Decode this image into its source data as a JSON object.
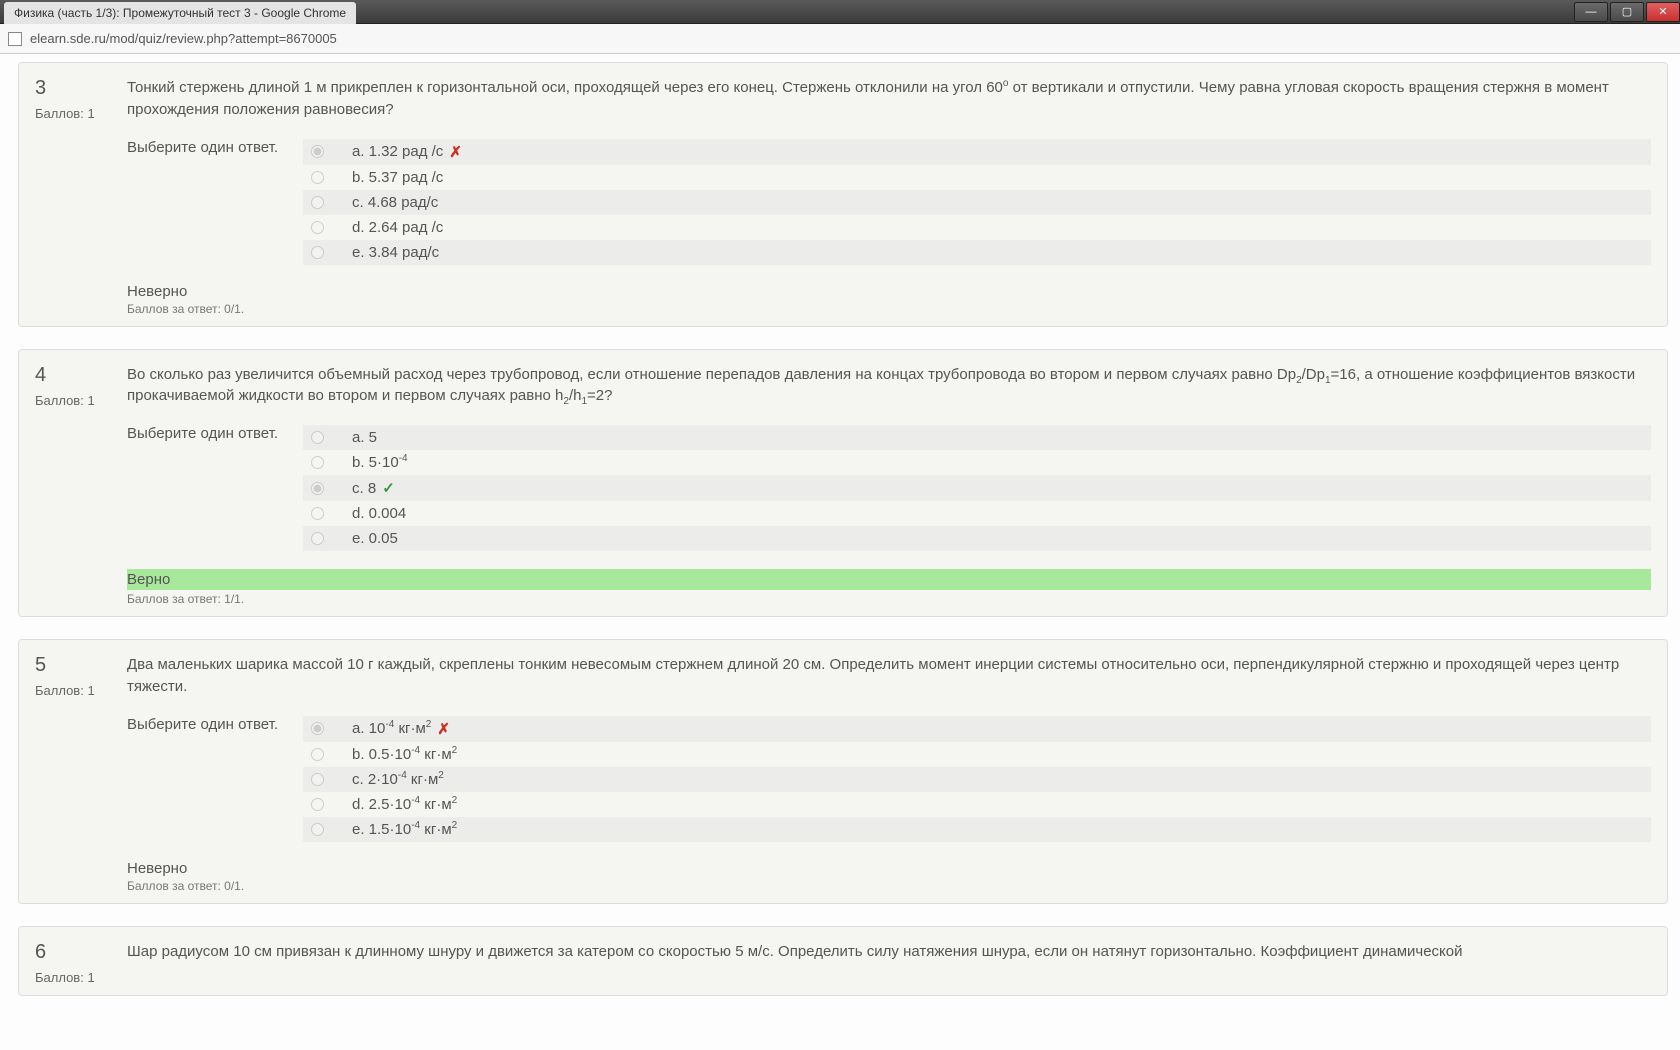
{
  "window": {
    "title": "Физика (часть 1/3): Промежуточный тест 3 - Google Chrome",
    "url": "elearn.sde.ru/mod/quiz/review.php?attempt=8670005"
  },
  "labels": {
    "points": "Баллов: 1",
    "choose": "Выберите один ответ.",
    "score_wrong": "Баллов за ответ: 0/1.",
    "score_right": "Баллов за ответ: 1/1.",
    "wrong": "Неверно",
    "right": "Верно"
  },
  "questions": [
    {
      "num": "3",
      "text_html": "Тонкий стержень длиной 1 м прикреплен к горизонтальной оси, проходящей через его конец. Стержень отклонили на угол 60<sup>o</sup> от вертикали и отпустили. Чему равна угловая скорость вращения стержня в момент прохождения положения равновесия?",
      "answers": [
        {
          "label": "a. 1.32 рад /с",
          "selected": true,
          "mark": "wrong"
        },
        {
          "label": "b. 5.37 рад /с",
          "selected": false
        },
        {
          "label": "c. 4.68 рад/с",
          "selected": false
        },
        {
          "label": "d. 2.64 рад /с",
          "selected": false
        },
        {
          "label": "e. 3.84 рад/с",
          "selected": false
        }
      ],
      "verdict": "wrong"
    },
    {
      "num": "4",
      "text_html": "Во сколько раз увеличится объемный расход через трубопровод, если отношение перепадов давления на концах трубопровода во втором и первом случаях равно Dp<sub>2</sub>/Dp<sub>1</sub>=16, а отношение коэффициентов вязкости прокачиваемой жидкости во втором и первом случаях равно h<sub>2</sub>/h<sub>1</sub>=2?",
      "answers": [
        {
          "label": "a. 5",
          "selected": false
        },
        {
          "label_html": "b. 5·10<sup>-4</sup>",
          "selected": false
        },
        {
          "label": "c. 8",
          "selected": true,
          "mark": "right"
        },
        {
          "label": "d. 0.004",
          "selected": false
        },
        {
          "label": "e. 0.05",
          "selected": false
        }
      ],
      "verdict": "right"
    },
    {
      "num": "5",
      "text_html": "Два маленьких шарика массой 10 г каждый, скреплены тонким невесомым стержнем длиной 20 см. Определить момент инерции системы относительно оси, перпендикулярной стержню и проходящей через центр тяжести.",
      "answers": [
        {
          "label_html": "a. 10<sup>-4</sup> кг·м<sup>2</sup>",
          "selected": true,
          "mark": "wrong"
        },
        {
          "label_html": "b. 0.5·10<sup>-4</sup> кг·м<sup>2</sup>",
          "selected": false
        },
        {
          "label_html": "c. 2·10<sup>-4</sup> кг·м<sup>2</sup>",
          "selected": false
        },
        {
          "label_html": "d. 2.5·10<sup>-4</sup> кг·м<sup>2</sup>",
          "selected": false
        },
        {
          "label_html": "e. 1.5·10<sup>-4</sup> кг·м<sup>2</sup>",
          "selected": false
        }
      ],
      "verdict": "wrong"
    },
    {
      "num": "6",
      "text_html": "Шар радиусом 10 см привязан к длинному шнуру и движется за катером со скоростью 5 м/с. Определить силу натяжения шнура, если он натянут горизонтально. Коэффициент динамической",
      "answers": [],
      "verdict": null,
      "partial": true
    }
  ]
}
